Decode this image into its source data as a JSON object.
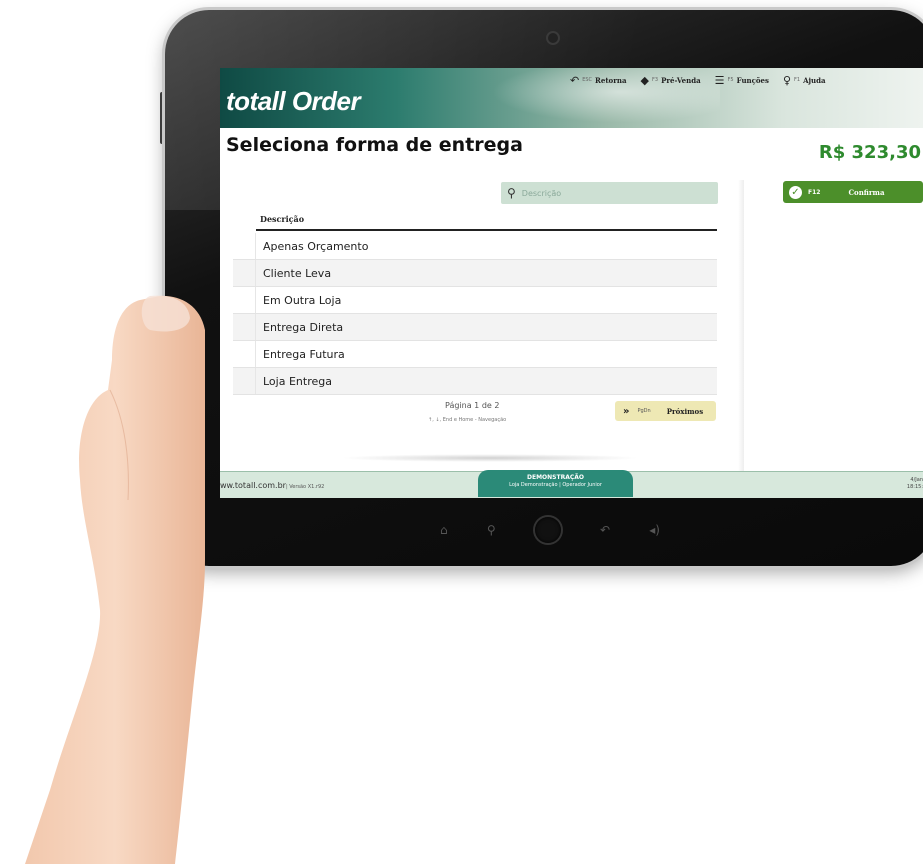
{
  "header": {
    "logo": "totall Order",
    "toolbar": [
      {
        "icon": "return-arrow-icon",
        "key": "ESC",
        "label": "Retorna"
      },
      {
        "icon": "tag-icon",
        "key": "F3",
        "label": "Pré-Venda"
      },
      {
        "icon": "list-icon",
        "key": "F5",
        "label": "Funções"
      },
      {
        "icon": "help-person-icon",
        "key": "F1",
        "label": "Ajuda"
      }
    ]
  },
  "page": {
    "title": "Seleciona forma de entrega",
    "total": "R$ 323,30"
  },
  "confirm": {
    "key": "F12",
    "label": "Confirma"
  },
  "search": {
    "placeholder": "Descrição"
  },
  "table": {
    "column": "Descrição",
    "rows": [
      "Apenas Orçamento",
      "Cliente Leva",
      "Em Outra Loja",
      "Entrega Direta",
      "Entrega Futura",
      "Loja Entrega"
    ]
  },
  "pagination": {
    "info": "Página 1 de 2",
    "hint": "↑, ↓, End e Home - Navegação",
    "next_key": "PgDn",
    "next_label": "Próximos"
  },
  "footer": {
    "site": "ww.totall.com.br",
    "version": "| Versão X1.r92",
    "mode": "DEMONSTRAÇÃO",
    "store": "Loja Demonstração | Operador Junior",
    "date": "4/Jan",
    "time": "18:15:"
  }
}
